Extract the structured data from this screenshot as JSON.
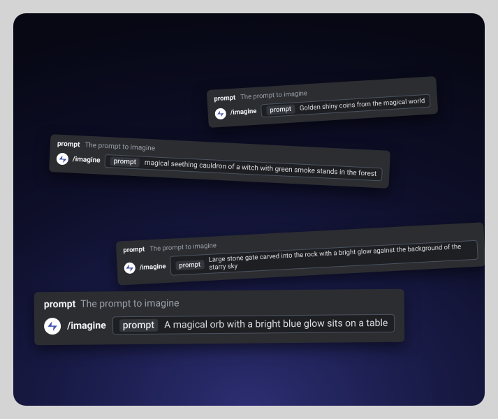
{
  "common": {
    "prompt_label": "prompt",
    "prompt_desc": "The prompt to imagine",
    "command": "/imagine",
    "pill_tag": "prompt"
  },
  "cards": [
    {
      "value": "Golden shiny coins from the magical world"
    },
    {
      "value": "magical seething cauldron of a witch with green smoke stands in the forest"
    },
    {
      "value": "Large stone gate carved into the rock with a bright glow against the background of the starry sky"
    },
    {
      "value": "A magical orb with a bright blue glow sits on a table"
    }
  ]
}
